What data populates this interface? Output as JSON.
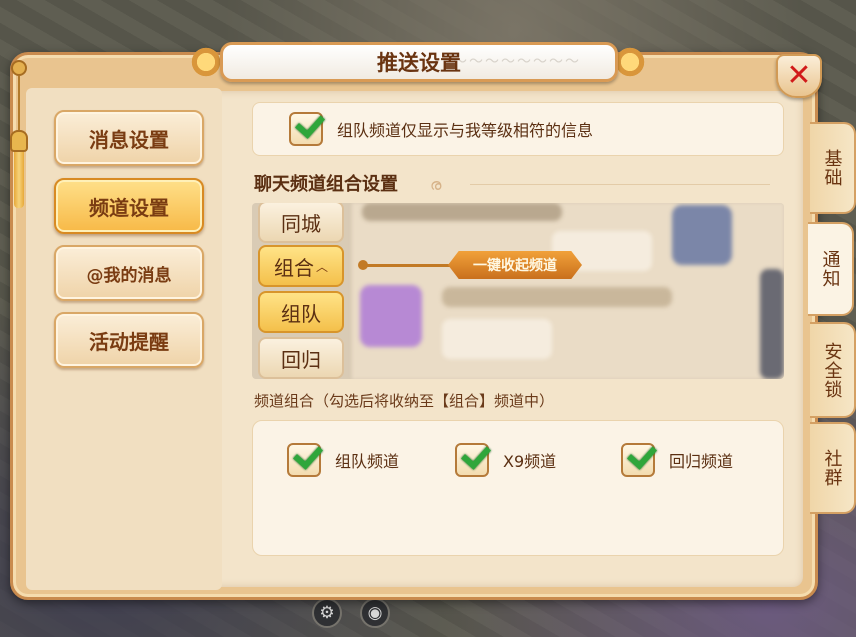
{
  "window": {
    "title": "推送设置",
    "close_icon": "close-icon"
  },
  "nav": {
    "items": [
      {
        "label": "消息设置",
        "active": false
      },
      {
        "label": "频道设置",
        "active": true
      },
      {
        "label": "@我的消息",
        "active": false
      },
      {
        "label": "活动提醒",
        "active": false
      }
    ]
  },
  "side_tabs": [
    {
      "label": "基础",
      "active": false
    },
    {
      "label": "通知",
      "active": true
    },
    {
      "label": "安全锁",
      "active": false
    },
    {
      "label": "社群",
      "active": false
    }
  ],
  "top_option": {
    "label": "组队频道仅显示与我等级相符的信息",
    "checked": true
  },
  "section": {
    "title": "聊天频道组合设置"
  },
  "preview": {
    "channel_tabs": [
      "同城",
      "组合",
      "组队",
      "回归"
    ],
    "tooltip": "一键收起频道"
  },
  "group": {
    "caption": "频道组合（勾选后将收纳至【组合】频道中）",
    "options": [
      {
        "label": "组队频道",
        "checked": true
      },
      {
        "label": "X9频道",
        "checked": true
      },
      {
        "label": "回归频道",
        "checked": true
      }
    ]
  },
  "colors": {
    "accent": "#f7b947",
    "check": "#2fa63b",
    "close": "#d11a1a",
    "text": "#5b2f12"
  }
}
